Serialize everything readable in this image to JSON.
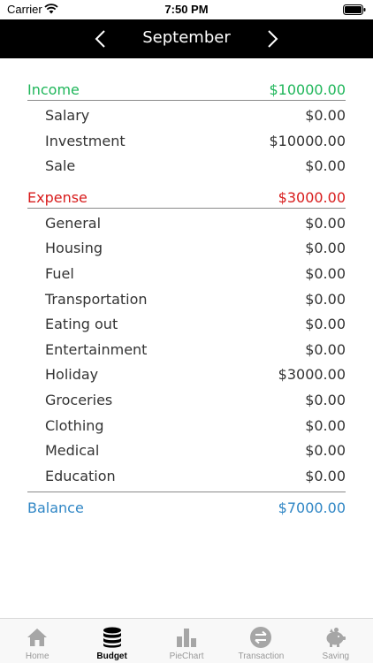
{
  "status_bar": {
    "carrier": "Carrier",
    "time": "7:50 PM"
  },
  "header": {
    "title": "September"
  },
  "income": {
    "label": "Income",
    "total": "$10000.00",
    "items": [
      {
        "label": "Salary",
        "amount": "$0.00"
      },
      {
        "label": "Investment",
        "amount": "$10000.00"
      },
      {
        "label": "Sale",
        "amount": "$0.00"
      }
    ]
  },
  "expense": {
    "label": "Expense",
    "total": "$3000.00",
    "items": [
      {
        "label": "General",
        "amount": "$0.00"
      },
      {
        "label": "Housing",
        "amount": "$0.00"
      },
      {
        "label": "Fuel",
        "amount": "$0.00"
      },
      {
        "label": "Transportation",
        "amount": "$0.00"
      },
      {
        "label": "Eating out",
        "amount": "$0.00"
      },
      {
        "label": "Entertainment",
        "amount": "$0.00"
      },
      {
        "label": "Holiday",
        "amount": "$3000.00"
      },
      {
        "label": "Groceries",
        "amount": "$0.00"
      },
      {
        "label": "Clothing",
        "amount": "$0.00"
      },
      {
        "label": "Medical",
        "amount": "$0.00"
      },
      {
        "label": "Education",
        "amount": "$0.00"
      }
    ]
  },
  "balance": {
    "label": "Balance",
    "amount": "$7000.00"
  },
  "colors": {
    "income": "#1fb65a",
    "expense": "#d81c1c",
    "balance": "#2f86c5"
  },
  "tabs": [
    {
      "label": "Home",
      "icon": "home-icon",
      "active": false
    },
    {
      "label": "Budget",
      "icon": "coins-icon",
      "active": true
    },
    {
      "label": "PieChart",
      "icon": "bar-chart-icon",
      "active": false
    },
    {
      "label": "Transaction",
      "icon": "transfer-icon",
      "active": false
    },
    {
      "label": "Saving",
      "icon": "piggy-bank-icon",
      "active": false
    }
  ]
}
